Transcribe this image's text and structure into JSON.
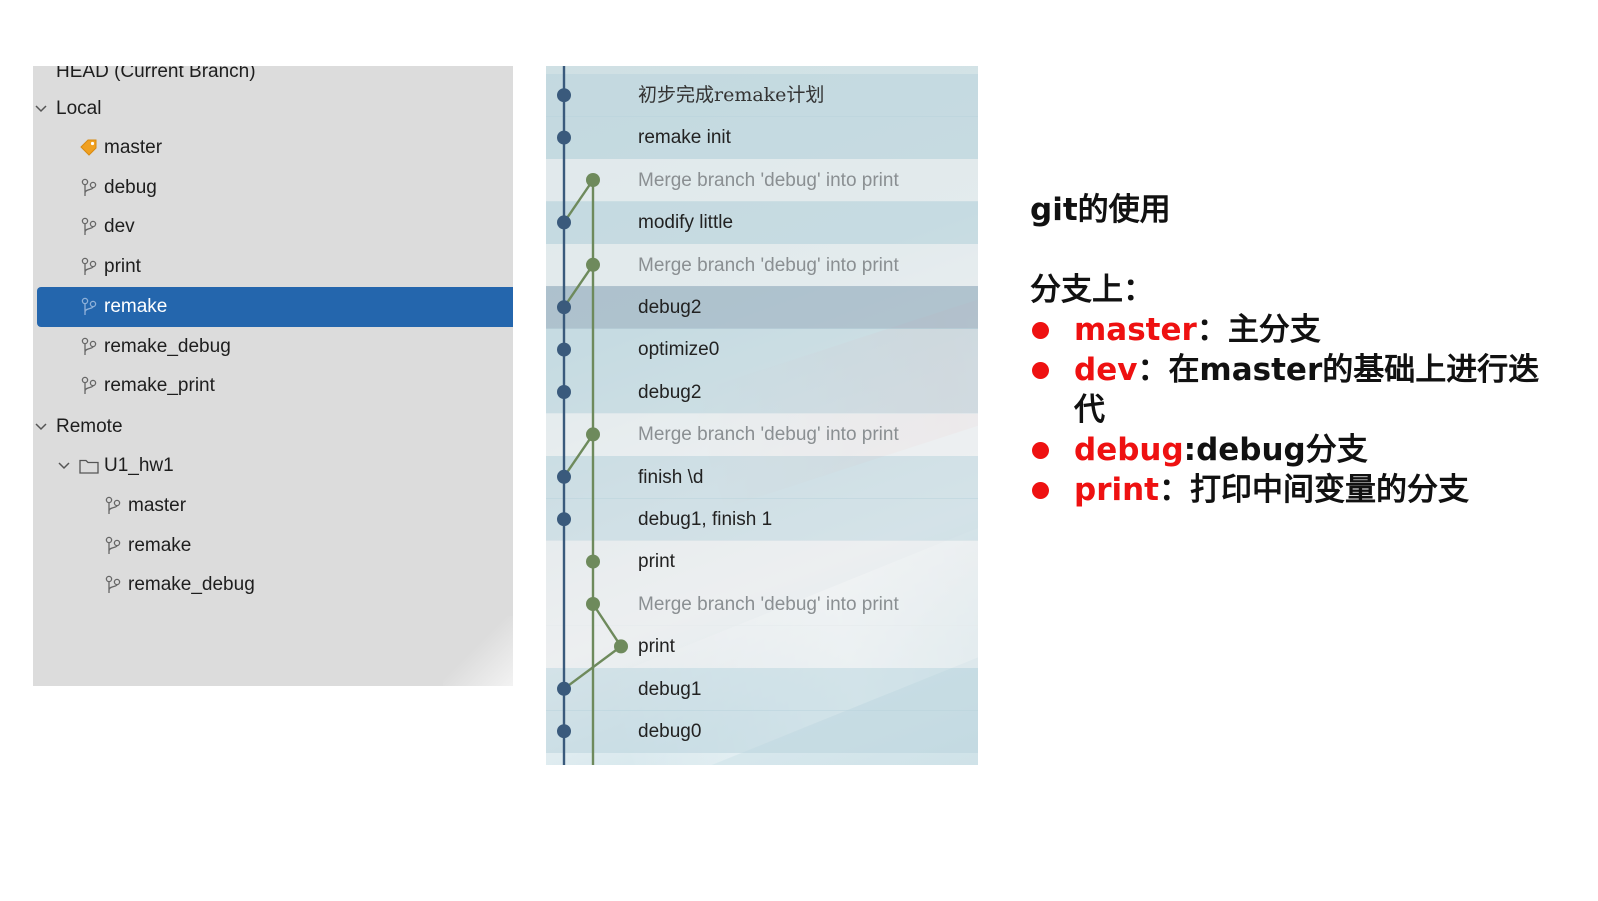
{
  "branch_tree": {
    "head_label": "HEAD (Current Branch)",
    "local_label": "Local",
    "local_branches": [
      {
        "name": "master",
        "icon": "tag-icon",
        "current": false
      },
      {
        "name": "debug",
        "icon": "branch-icon",
        "current": false
      },
      {
        "name": "dev",
        "icon": "branch-icon",
        "current": false
      },
      {
        "name": "print",
        "icon": "branch-icon",
        "current": false
      },
      {
        "name": "remake",
        "icon": "branch-icon",
        "current": true
      },
      {
        "name": "remake_debug",
        "icon": "branch-icon",
        "current": false
      },
      {
        "name": "remake_print",
        "icon": "branch-icon",
        "current": false
      }
    ],
    "remote_label": "Remote",
    "remote_folder": "U1_hw1",
    "remote_branches": [
      {
        "name": "master",
        "icon": "branch-icon"
      },
      {
        "name": "remake",
        "icon": "branch-icon"
      },
      {
        "name": "remake_debug",
        "icon": "branch-icon"
      }
    ],
    "colors": {
      "panel_bg": "#dcdcdc",
      "selected_bg": "#2466ad",
      "tag_icon": "#f0a020"
    }
  },
  "commits": [
    {
      "message": "初步完成remake计划",
      "lane": "main",
      "merge": false
    },
    {
      "message": "remake init",
      "lane": "main",
      "merge": false
    },
    {
      "message": "Merge branch 'debug' into print",
      "lane": "side",
      "merge": true
    },
    {
      "message": "modify little",
      "lane": "main",
      "merge": false
    },
    {
      "message": "Merge branch 'debug' into print",
      "lane": "side",
      "merge": true
    },
    {
      "message": "debug2",
      "lane": "main",
      "merge": false,
      "selected": true
    },
    {
      "message": "optimize0",
      "lane": "main",
      "merge": false
    },
    {
      "message": "debug2",
      "lane": "main",
      "merge": false
    },
    {
      "message": "Merge branch 'debug' into print",
      "lane": "side",
      "merge": true
    },
    {
      "message": "finish \\d",
      "lane": "main",
      "merge": false
    },
    {
      "message": "debug1, finish 1",
      "lane": "main",
      "merge": false
    },
    {
      "message": "print",
      "lane": "side",
      "merge": false
    },
    {
      "message": "Merge branch 'debug' into print",
      "lane": "side",
      "merge": true
    },
    {
      "message": "print",
      "lane": "third",
      "merge": false
    },
    {
      "message": "debug1",
      "lane": "main",
      "merge": false
    },
    {
      "message": "debug0",
      "lane": "main",
      "merge": false
    }
  ],
  "graph_colors": {
    "main": "#3a5a7c",
    "side": "#6e8a5c"
  },
  "notes": {
    "title": "git的使用",
    "subtitle": "分支上：",
    "items": [
      {
        "key": "master",
        "sep": "：",
        "desc": "主分支"
      },
      {
        "key": "dev",
        "sep": "：",
        "desc": "在master的基础上进行迭代"
      },
      {
        "key": "debug",
        "sep": ":",
        "desc": "debug分支"
      },
      {
        "key": "print",
        "sep": "：",
        "desc": "打印中间变量的分支"
      }
    ],
    "accent_color": "#ee1111"
  }
}
